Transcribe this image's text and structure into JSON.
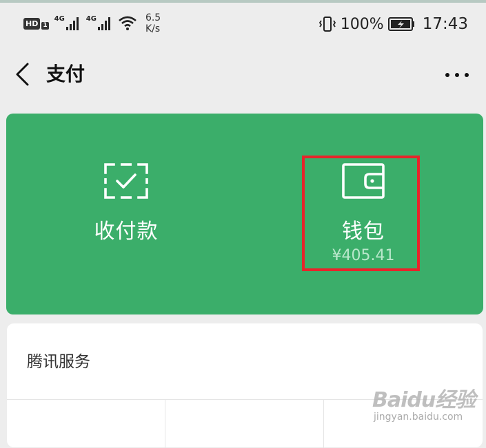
{
  "status_bar": {
    "hd_label": "HD",
    "hd_sub": "1",
    "network_1": "4G",
    "network_2": "4G",
    "speed_value": "6.5",
    "speed_unit": "K/s",
    "battery_percent": "100%",
    "time": "17:43",
    "icons": [
      "hd-icon",
      "signal-icon",
      "signal-icon",
      "wifi-icon",
      "vibrate-icon",
      "battery-charging-icon"
    ]
  },
  "nav": {
    "title": "支付",
    "back_icon": "chevron-left-icon",
    "more_icon": "more-dots-icon"
  },
  "pay_card": {
    "color": "#3bae6a",
    "receive": {
      "label": "收付款",
      "icon": "scan-check-icon"
    },
    "wallet": {
      "label": "钱包",
      "balance": "¥405.41",
      "icon": "wallet-icon"
    },
    "highlight_color": "#e8242a"
  },
  "services": {
    "title": "腾讯服务"
  },
  "watermark": {
    "brand": "Baidu经验",
    "site": "jingyan.baidu.com"
  }
}
